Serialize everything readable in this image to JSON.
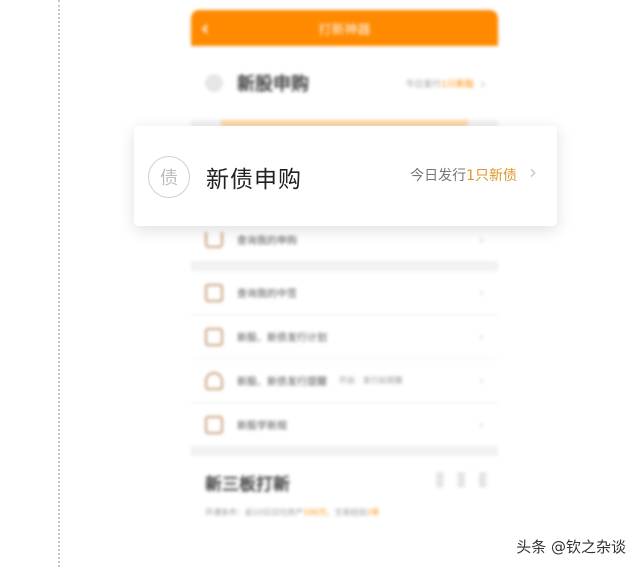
{
  "topbar": {
    "back_icon": "chevron-left-icon",
    "title": "打新神器"
  },
  "stock_row": {
    "title": "新股申购",
    "info_prefix": "今日发行",
    "info_highlight": "1只新股"
  },
  "bond_card": {
    "badge": "债",
    "title": "新债申购",
    "info_prefix": "今日发行",
    "info_highlight": "1只新债"
  },
  "menu": {
    "purchase": "查询我的申购",
    "winning": "查询我的中签",
    "plan": "新股、新债发行计划",
    "remind": "新股、新债发行提醒",
    "remind_tag": "开启 · 发行前提醒",
    "school": "新股学新规"
  },
  "board": {
    "title": "新三板打新",
    "sub_prefix": "开通条件：前10日日均资产",
    "sub_highlight1": "100万",
    "sub_mid": "，交易经验",
    "sub_highlight2": "2年"
  },
  "watermark": "头条 @钦之杂谈",
  "colors": {
    "accent": "#ff8a00",
    "highlight": "#e0952a"
  }
}
